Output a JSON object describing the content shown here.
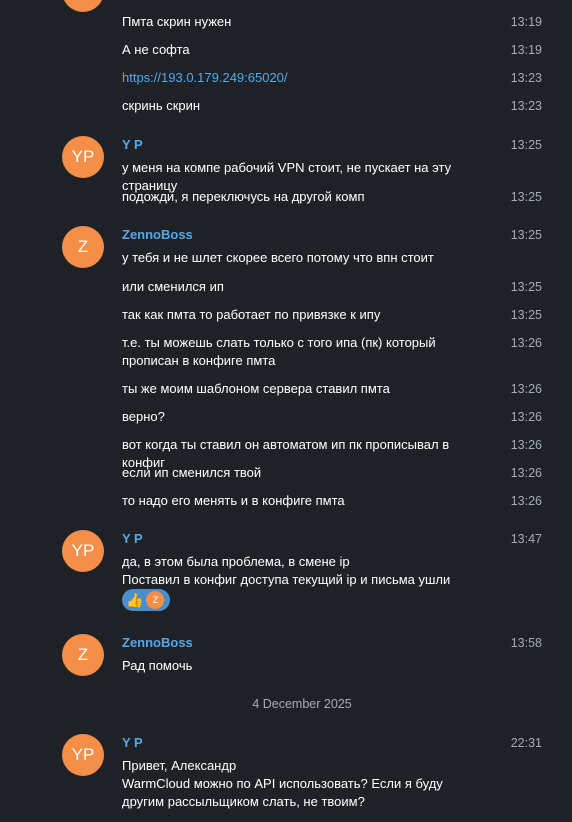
{
  "msgs_top": [
    {
      "text": "Пмта скрин нужен",
      "time": "13:19"
    },
    {
      "text": "А не софта",
      "time": "13:19"
    },
    {
      "text": "https://193.0.179.249:65020/",
      "time": "13:23"
    },
    {
      "text": "скринь скрин",
      "time": "13:23"
    }
  ],
  "group_yp1": {
    "initials": "YP",
    "name": "Y P",
    "time": "13:25",
    "first": "у меня на компе рабочий VPN стоит, не пускает на эту страницу",
    "second": {
      "text": "подожди, я переключусь на другой комп",
      "time": "13:25"
    }
  },
  "group_z1": {
    "initials": "Z",
    "name": "ZennoBoss",
    "time": "13:25",
    "first": "у тебя и не шлет скорее всего потому что впн стоит",
    "items": [
      {
        "text": "или сменился ип",
        "time": "13:25"
      },
      {
        "text": "так как пмта то работает по привязке к ипу",
        "time": "13:25"
      },
      {
        "text": "т.е. ты можешь слать только с того ипа (пк) который прописан в конфиге пмта",
        "time": "13:26"
      },
      {
        "text": "ты же моим шаблоном сервера ставил пмта",
        "time": "13:26"
      },
      {
        "text": "верно?",
        "time": "13:26"
      },
      {
        "text": "вот когда ты ставил он автоматом ип пк прописывал в конфиг",
        "time": "13:26"
      },
      {
        "text": "если ип сменился твой",
        "time": "13:26"
      },
      {
        "text": "то надо его менять и в конфиге пмта",
        "time": "13:26"
      }
    ]
  },
  "group_yp2": {
    "initials": "YP",
    "name": "Y P",
    "time": "13:47",
    "line1": "да, в этом была проблема, в смене ip",
    "line2": "Поставил в конфиг доступа текущий ip и письма ушли",
    "reaction_initial": "Z"
  },
  "group_z2": {
    "initials": "Z",
    "name": "ZennoBoss",
    "time": "13:58",
    "text": "Рад помочь"
  },
  "date_separator": "4 December 2025",
  "group_yp3": {
    "initials": "YP",
    "name": "Y P",
    "time": "22:31",
    "line1": "Привет, Александр",
    "line2": "WarmCloud можно по API использовать? Если я буду другим рассыльщиком слать, не твоим?"
  },
  "colors": {
    "background": "#1e2227",
    "avatar": "#f58f47",
    "name": "#54a9eb",
    "time": "#a3acb6"
  }
}
